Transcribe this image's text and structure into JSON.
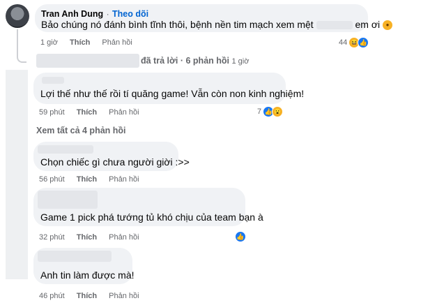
{
  "comments": [
    {
      "author": "Tran Anh Dung",
      "follow": "Theo dõi",
      "separator": "·",
      "text_before": "Bảo chúng nó đánh bình tĩnh thôi, bệnh nền tim mạch xem mệt",
      "text_after": "em ơi",
      "time": "1 giờ",
      "like": "Thích",
      "reply": "Phản hồi",
      "reaction_count": "44"
    },
    {
      "text": "Lợi thế như thế rồi tí quăng game! Vẫn còn non kinh nghiệm!",
      "time": "59 phút",
      "like": "Thích",
      "reply": "Phản hồi",
      "reaction_count": "7"
    },
    {
      "text": "Chọn chiếc gì chưa người giời :>>",
      "time": "56 phút",
      "like": "Thích",
      "reply": "Phản hồi"
    },
    {
      "text": "Game 1 pick phá tướng tủ khó chịu của team bạn à",
      "time": "32 phút",
      "like": "Thích",
      "reply": "Phản hồi"
    },
    {
      "text": "Anh tin làm được mà!",
      "time": "46 phút",
      "like": "Thích",
      "reply": "Phản hồi"
    }
  ],
  "reply_summary": {
    "replied": "đã trả lời",
    "separator": "·",
    "count": "6 phản hồi",
    "time": "1 giờ"
  },
  "view_more": "Xem tất cả 4 phản hồi",
  "colors": {
    "bubble": "#f0f2f5",
    "link": "#0064d1",
    "like": "#1877f2",
    "meta": "#65676b"
  },
  "icons": [
    "like-icon",
    "haha-icon",
    "wow-icon"
  ]
}
